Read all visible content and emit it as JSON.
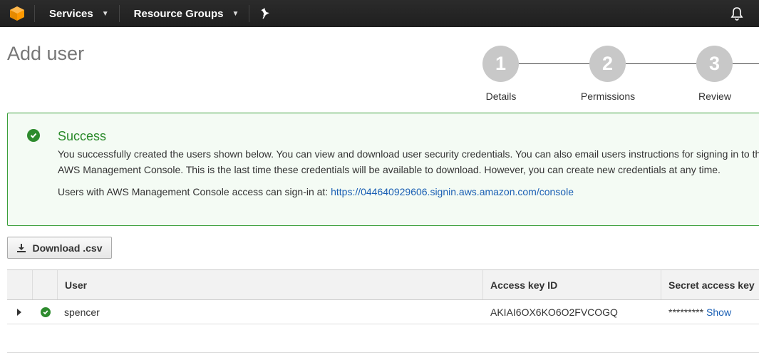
{
  "nav": {
    "services_label": "Services",
    "resource_groups_label": "Resource Groups"
  },
  "page": {
    "title": "Add user"
  },
  "stepper": {
    "steps": [
      {
        "number": "1",
        "label": "Details"
      },
      {
        "number": "2",
        "label": "Permissions"
      },
      {
        "number": "3",
        "label": "Review"
      }
    ]
  },
  "success": {
    "title": "Success",
    "message": "You successfully created the users shown below. You can view and download user security credentials. You can also email users instructions for signing in to the AWS Management Console. This is the last time these credentials will be available to download. However, you can create new credentials at any time.",
    "signin_prefix": "Users with AWS Management Console access can sign-in at: ",
    "signin_url": "https://044640929606.signin.aws.amazon.com/console"
  },
  "download_button": {
    "label": "Download .csv"
  },
  "table": {
    "headers": {
      "user": "User",
      "access_key_id": "Access key ID",
      "secret_access_key": "Secret access key"
    },
    "rows": [
      {
        "user": "spencer",
        "access_key_id": "AKIAI6OX6KO6O2FVCOGQ",
        "secret_masked": "*********",
        "show_label": "Show"
      }
    ]
  },
  "colors": {
    "success_green": "#2e8b2e",
    "link_blue": "#1a5fb4",
    "nav_bg": "#232323",
    "step_gray": "#c8c8c8"
  },
  "icons": [
    "aws-cube-icon",
    "chevron-down-icon",
    "pin-icon",
    "bell-icon",
    "check-circle-icon",
    "download-icon",
    "triangle-right-icon"
  ]
}
